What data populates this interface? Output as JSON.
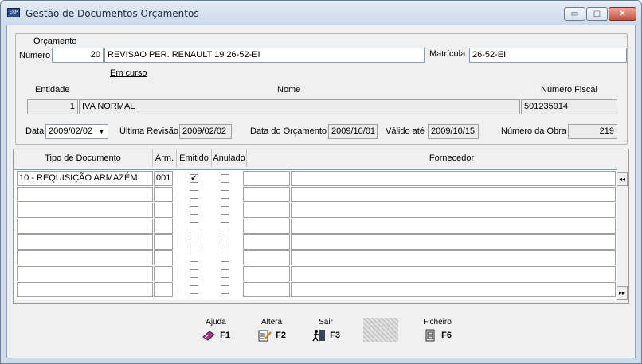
{
  "window": {
    "title": "Gestão de Documentos Orçamentos",
    "icon": "app-icon",
    "controls": {
      "minimize": "▭",
      "maximize": "▢",
      "close": "✕"
    }
  },
  "orcamento": {
    "legend": "Orçamento",
    "numero_label": "Número",
    "numero": "20",
    "descricao": "REVISAO PER. RENAULT 19 26-52-EI",
    "matricula_label": "Matrícula",
    "matricula": "26-52-EI",
    "estado": "Em curso",
    "entidade_header": "Entidade",
    "nome_header": "Nome",
    "nif_header": "Número Fiscal",
    "entidade": "1",
    "nome": "IVA NORMAL",
    "nif": "501235914",
    "data_label": "Data",
    "data": "2009/02/02",
    "ultima_revisao_label": "Última Revisão",
    "ultima_revisao": "2009/02/02",
    "data_orcamento_label": "Data do Orçamento",
    "data_orcamento": "2009/10/01",
    "valido_label": "Válido até",
    "valido": "2009/10/15",
    "numero_obra_label": "Número da Obra",
    "numero_obra": "219"
  },
  "grid": {
    "headers": {
      "tipo": "Tipo de Documento",
      "arm": "Arm.",
      "emitido": "Emitido",
      "anulado": "Anulado",
      "fornecedor": "Fornecedor"
    },
    "rows": [
      {
        "tipo": "10 - REQUISIÇÃO ARMAZÉM",
        "arm": "001",
        "emitido": "✔",
        "anulado": ""
      },
      {
        "tipo": "",
        "arm": "",
        "emitido": "",
        "anulado": ""
      },
      {
        "tipo": "",
        "arm": "",
        "emitido": "",
        "anulado": ""
      },
      {
        "tipo": "",
        "arm": "",
        "emitido": "",
        "anulado": ""
      },
      {
        "tipo": "",
        "arm": "",
        "emitido": "",
        "anulado": ""
      },
      {
        "tipo": "",
        "arm": "",
        "emitido": "",
        "anulado": ""
      },
      {
        "tipo": "",
        "arm": "",
        "emitido": "",
        "anulado": ""
      },
      {
        "tipo": "",
        "arm": "",
        "emitido": "",
        "anulado": ""
      }
    ],
    "scroll_up": "◂◂",
    "scroll_down": "▸▸"
  },
  "function_keys": {
    "ajuda": {
      "label": "Ajuda",
      "key": "F1",
      "icon": "book-icon"
    },
    "altera": {
      "label": "Altera",
      "key": "F2",
      "icon": "edit-icon"
    },
    "sair": {
      "label": "Sair",
      "key": "F3",
      "icon": "exit-icon"
    },
    "ficheiro": {
      "label": "Ficheiro",
      "key": "F6",
      "icon": "cabinet-icon"
    }
  }
}
